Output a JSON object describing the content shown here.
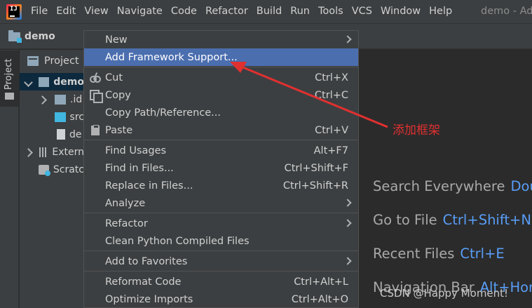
{
  "menubar": {
    "logo_text": "IJ",
    "items": [
      "File",
      "Edit",
      "View",
      "Navigate",
      "Code",
      "Refactor",
      "Build",
      "Run",
      "Tools",
      "VCS",
      "Window",
      "Help"
    ],
    "window_title": "demo - Ad"
  },
  "navbar": {
    "breadcrumb": "demo"
  },
  "stripe": {
    "project_tab": "Project"
  },
  "project_panel": {
    "title": "Project",
    "tree": [
      {
        "label": "demo",
        "icon": "module-folder-icon",
        "expanded": true,
        "selected": true
      },
      {
        "label": ".id",
        "icon": "folder-icon",
        "expanded": false
      },
      {
        "label": "src",
        "icon": "source-folder-icon"
      },
      {
        "label": "de",
        "icon": "file-icon"
      },
      {
        "label": "Extern",
        "icon": "library-icon",
        "expanded": false
      },
      {
        "label": "Scratc",
        "icon": "scratch-icon"
      }
    ]
  },
  "context_menu": {
    "items": [
      {
        "label": "New",
        "shortcut": "",
        "submenu": true,
        "icon": ""
      },
      {
        "label": "Add Framework Support...",
        "shortcut": "",
        "submenu": false,
        "highlighted": true,
        "icon": ""
      },
      {
        "label": "Cut",
        "shortcut": "Ctrl+X",
        "submenu": false,
        "icon": "cut-icon"
      },
      {
        "label": "Copy",
        "shortcut": "Ctrl+C",
        "submenu": false,
        "icon": "copy-icon"
      },
      {
        "label": "Copy Path/Reference...",
        "shortcut": "",
        "submenu": false,
        "icon": ""
      },
      {
        "label": "Paste",
        "shortcut": "Ctrl+V",
        "submenu": false,
        "icon": "paste-icon"
      },
      {
        "label": "Find Usages",
        "shortcut": "Alt+F7",
        "submenu": false,
        "icon": ""
      },
      {
        "label": "Find in Files...",
        "shortcut": "Ctrl+Shift+F",
        "submenu": false,
        "icon": ""
      },
      {
        "label": "Replace in Files...",
        "shortcut": "Ctrl+Shift+R",
        "submenu": false,
        "icon": ""
      },
      {
        "label": "Analyze",
        "shortcut": "",
        "submenu": true,
        "icon": ""
      },
      {
        "label": "Refactor",
        "shortcut": "",
        "submenu": true,
        "icon": ""
      },
      {
        "label": "Clean Python Compiled Files",
        "shortcut": "",
        "submenu": false,
        "icon": ""
      },
      {
        "label": "Add to Favorites",
        "shortcut": "",
        "submenu": true,
        "icon": ""
      },
      {
        "label": "Reformat Code",
        "shortcut": "Ctrl+Alt+L",
        "submenu": false,
        "icon": ""
      },
      {
        "label": "Optimize Imports",
        "shortcut": "Ctrl+Alt+O",
        "submenu": false,
        "icon": ""
      }
    ]
  },
  "editor_hints": [
    {
      "label": "Search Everywhere",
      "key": "Dou"
    },
    {
      "label": "Go to File",
      "key": "Ctrl+Shift+N"
    },
    {
      "label": "Recent Files",
      "key": "Ctrl+E"
    },
    {
      "label": "Navigation Bar",
      "key": "Alt+Hor"
    }
  ],
  "annotation": {
    "text": "添加框架",
    "color": "#e03030"
  },
  "watermark": "CSDN @Happy Moment!",
  "colors": {
    "menu_bg": "#3c3f41",
    "editor_bg": "#2b2b2b",
    "highlight": "#4b6eaf",
    "selection": "#0d293e",
    "shortcut_key": "#589df6"
  }
}
